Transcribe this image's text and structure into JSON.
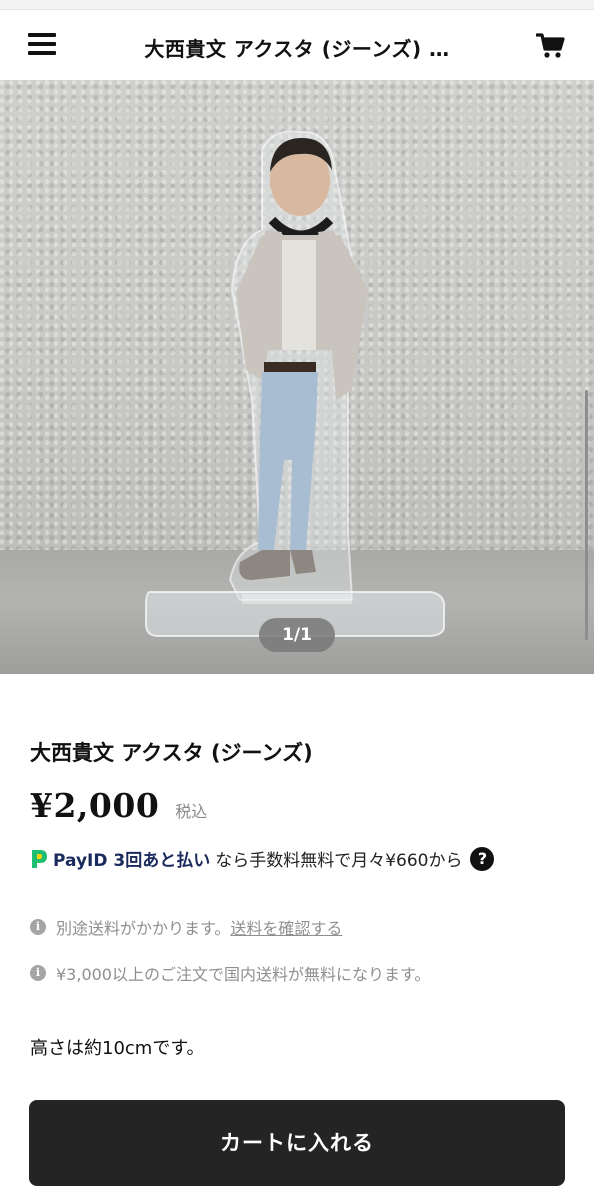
{
  "header": {
    "title": "大西貴文 アクスタ (ジーンズ) …",
    "menu_icon": "hamburger-menu-icon",
    "cart_icon": "shopping-cart-icon"
  },
  "gallery": {
    "image_alt": "大西貴文 アクスタ (ジーンズ)",
    "pager": "1/1"
  },
  "product": {
    "name": "大西貴文 アクスタ (ジーンズ)",
    "price": "¥2,000",
    "tax_label": "税込",
    "payid": {
      "brand": "PayID 3回あと払い",
      "text": "なら手数料無料で月々¥660から",
      "help": "?"
    },
    "notes": {
      "shipping_separate": "別途送料がかかります。",
      "shipping_link": "送料を確認する",
      "free_shipping": "¥3,000以上のご注文で国内送料が無料になります。"
    },
    "description": "高さは約10cmです。"
  },
  "actions": {
    "add_to_cart": "カートに入れる"
  },
  "colors": {
    "button_bg": "#242424",
    "muted_text": "#8f8f8f",
    "payid_blue": "#1b2a5c",
    "payid_green": "#1fbf73"
  }
}
